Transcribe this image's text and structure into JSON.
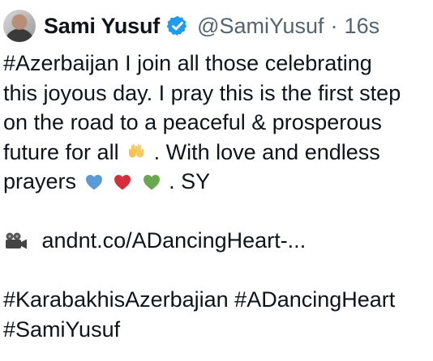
{
  "tweet": {
    "author_name": "Sami Yusuf",
    "handle": "@SamiYusuf",
    "separator": "·",
    "timestamp": "16s",
    "verified_icon": "verified-badge-icon",
    "line1": "#Azerbaijan I join all those celebrating",
    "line2": "this joyous day. I pray this is the first step",
    "line3": "on the road to a peaceful & prosperous",
    "line4_start": "future for all",
    "line4_end": ". With love and endless",
    "line5_start": "prayers",
    "line5_end": ". SY",
    "link_text": "andnt.co/ADancingHeart-...",
    "hashtags_line1": "#KarabakhisAzerbajian #ADancingHeart",
    "hashtags_line2": "#SamiYusuf",
    "emoji": {
      "hands": "raised-hands-emoji",
      "blue_heart": "blue-heart-emoji",
      "red_heart": "red-heart-emoji",
      "green_heart": "green-heart-emoji",
      "camera": "movie-camera-emoji"
    },
    "colors": {
      "verified_blue": "#1d9bf0",
      "secondary_text": "#536471",
      "blue_heart": "#5b9bd5",
      "red_heart": "#d62f3c",
      "green_heart": "#6aa84f"
    }
  }
}
